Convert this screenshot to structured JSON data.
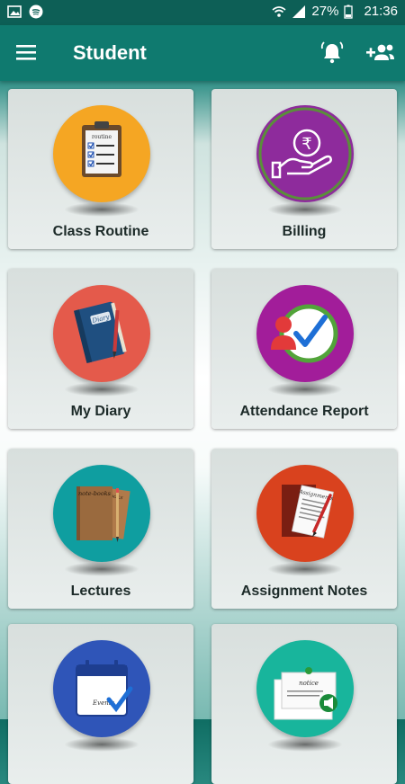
{
  "status_bar": {
    "battery": "27%",
    "time": "21:36",
    "icons": [
      "image-icon",
      "spotify-icon",
      "wifi-icon",
      "signal-icon",
      "battery-icon"
    ]
  },
  "app_bar": {
    "title": "Student",
    "icons": [
      "menu-icon",
      "notification-bell-icon",
      "add-user-icon"
    ]
  },
  "tiles": [
    {
      "label": "Class Routine",
      "icon": "routine-clipboard-icon",
      "color": "#f5a623"
    },
    {
      "label": "Billing",
      "icon": "rupee-hand-icon",
      "color": "#8e2b9c"
    },
    {
      "label": "My Diary",
      "icon": "diary-book-icon",
      "color": "#e45a4b"
    },
    {
      "label": "Attendance Report",
      "icon": "attendance-check-icon",
      "color": "#a21d9a"
    },
    {
      "label": "Lectures",
      "icon": "notebooks-icon",
      "color": "#0f9ea0"
    },
    {
      "label": "Assignment Notes",
      "icon": "assignment-notes-icon",
      "color": "#d9421e"
    },
    {
      "label": "",
      "icon": "events-calendar-icon",
      "color": "#2f55b8"
    },
    {
      "label": "",
      "icon": "notice-board-icon",
      "color": "#18b59c"
    }
  ]
}
